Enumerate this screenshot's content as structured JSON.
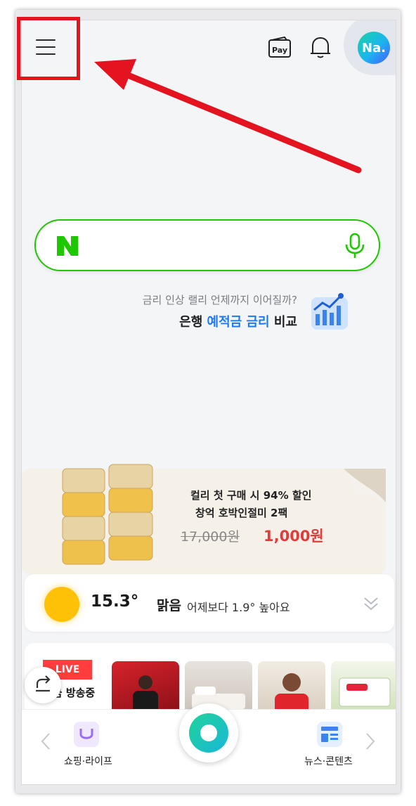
{
  "header": {
    "avatar_text": "Na.",
    "pay_label": "Pay"
  },
  "search": {
    "logo_text": "N"
  },
  "promo": {
    "subtitle": "금리 인상 랠리 언제까지 이어질까?",
    "main_prefix": "은행 ",
    "main_highlight": "예적금 금리",
    "main_suffix": " 비교"
  },
  "ad": {
    "line1": "컬리 첫 구매 시 94% 할인",
    "line2": "창억 호박인절미 2팩",
    "old_price": "17,000원",
    "new_price": "1,000원"
  },
  "weather": {
    "temperature": "15.3°",
    "condition": "맑음",
    "comparison": "어제보다 1.9° 높아요"
  },
  "live": {
    "badge": "LIVE",
    "label": "지금 방송중"
  },
  "bottom_nav": {
    "left_label": "쇼핑·라이프",
    "right_label": "뉴스·콘텐츠"
  },
  "colors": {
    "naver_green": "#1ec800",
    "highlight_blue": "#1e7af0",
    "price_red": "#e23b3b",
    "annotation_red": "#e3141f"
  },
  "icons": [
    "menu-icon",
    "pay-icon",
    "bell-icon",
    "microphone-icon",
    "chart-icon",
    "sun-icon",
    "chevron-down-icon",
    "refresh-icon",
    "shopping-bag-icon",
    "news-icon"
  ]
}
